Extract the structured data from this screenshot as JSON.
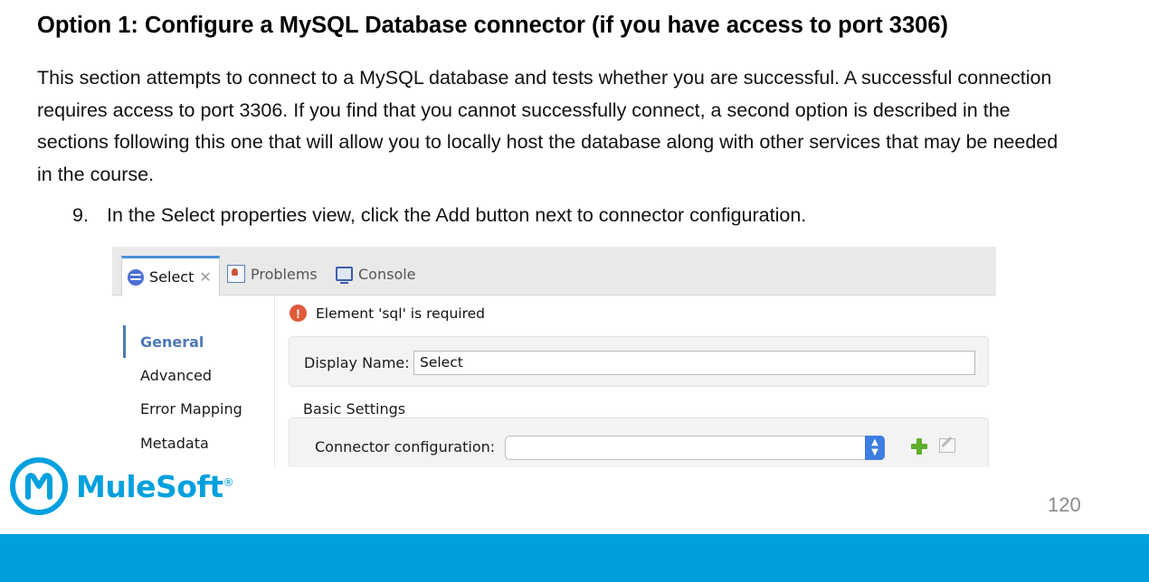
{
  "heading": "Option 1: Configure a MySQL Database connector (if you have access to port 3306)",
  "paragraph": "This section attempts to connect to a MySQL database and tests whether you are successful. A successful connection requires access to port 3306. If you find that you cannot successfully connect, a second option is described in the sections following this one that will allow you to locally host the database along with other services that may be needed in the course.",
  "step": {
    "number": "9.",
    "text": "In the Select properties view, click the Add button next to connector configuration."
  },
  "screenshot": {
    "tabs": [
      {
        "label": "Select",
        "icon": "database-icon",
        "active": true
      },
      {
        "label": "Problems",
        "icon": "problems-icon",
        "active": false
      },
      {
        "label": "Console",
        "icon": "console-icon",
        "active": false
      }
    ],
    "nav_items": [
      "General",
      "Advanced",
      "Error Mapping",
      "Metadata"
    ],
    "error_message": "Element 'sql' is required",
    "display_name_label": "Display Name:",
    "display_name_value": "Select",
    "basic_settings_title": "Basic Settings",
    "connector_config_label": "Connector configuration:",
    "connector_config_value": ""
  },
  "logo": {
    "name": "MuleSoft",
    "trademark": "®"
  },
  "page_number": "120",
  "colors": {
    "brand": "#00a0df",
    "error": "#e05a3a",
    "add": "#5fae2e",
    "nav_active": "#4c79b5"
  }
}
